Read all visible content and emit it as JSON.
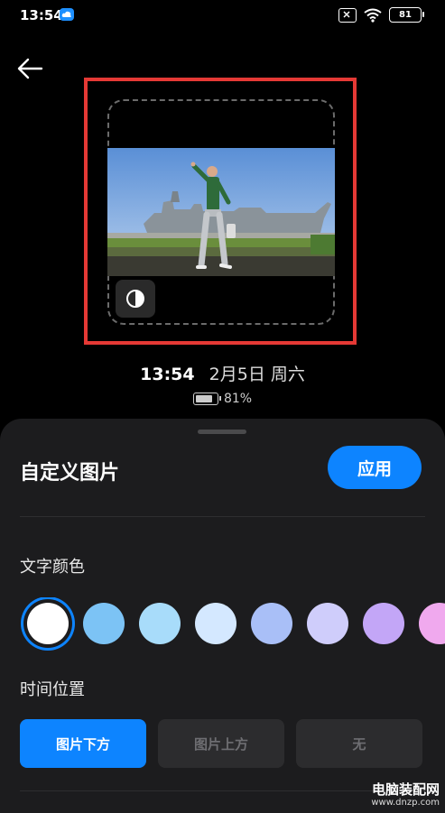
{
  "status_bar": {
    "time": "13:54",
    "battery": "81"
  },
  "preview": {
    "clock_time": "13:54",
    "clock_date": "2月5日 周六",
    "battery_percent": "81%"
  },
  "sheet": {
    "title": "自定义图片",
    "apply_label": "应用",
    "text_color_label": "文字颜色",
    "swatch_colors": [
      "#ffffff",
      "#7cc3f5",
      "#a8dcfa",
      "#d4e8ff",
      "#a9bff7",
      "#cfcdfb",
      "#c3a6f7",
      "#f0a9ee"
    ],
    "selected_swatch": 0,
    "time_position_label": "时间位置",
    "positions": [
      "图片下方",
      "图片上方",
      "无"
    ],
    "selected_position": 0
  },
  "watermark": {
    "text": "电脑装配网",
    "url": "www.dnzp.com"
  }
}
